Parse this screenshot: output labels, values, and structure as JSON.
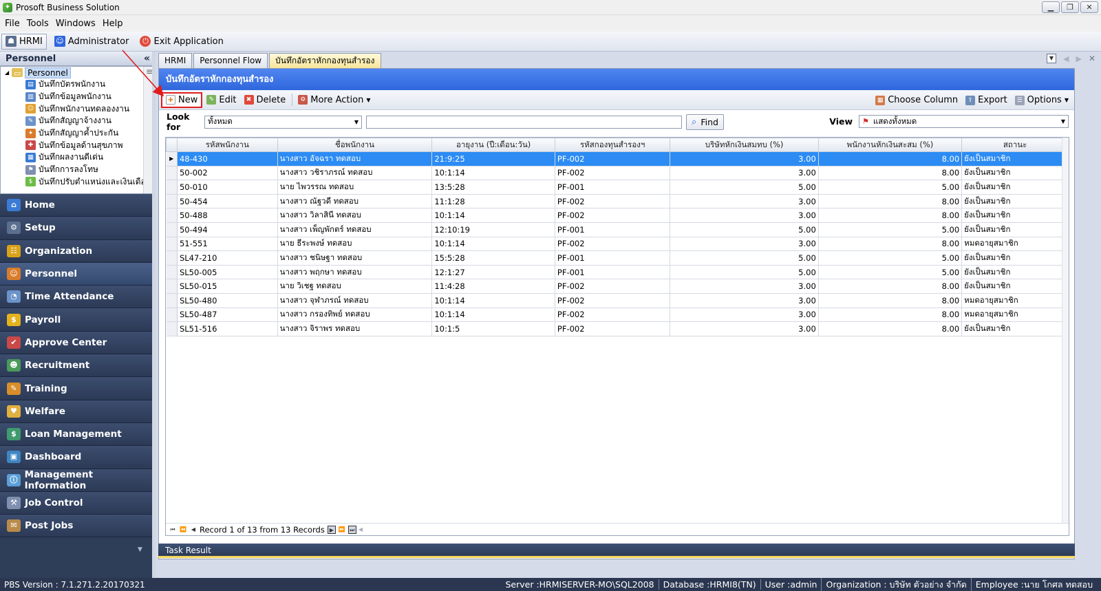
{
  "window": {
    "title": "Prosoft Business Solution",
    "controls": [
      "minimize",
      "restore",
      "close"
    ]
  },
  "menu": [
    "File",
    "Tools",
    "Windows",
    "Help"
  ],
  "toolbar": {
    "hrmi": "HRMI",
    "administrator": "Administrator",
    "exit": "Exit Application"
  },
  "sidebar": {
    "header": "Personnel",
    "tree_root": "Personnel",
    "tree_items": [
      "บันทึกบัตรพนักงาน",
      "บันทึกข้อมูลพนักงาน",
      "บันทึกพนักงานทดลองงาน",
      "บันทึกสัญญาจ้างงาน",
      "บันทึกสัญญาค้ำประกัน",
      "บันทึกข้อมูลด้านสุขภาพ",
      "บันทึกผลงานดีเด่น",
      "บันทึกการลงโทษ",
      "บันทึกปรับตำแหน่งและเงินเดือน"
    ],
    "nav": [
      {
        "label": "Home",
        "icon": "home-icon",
        "color": "#3a7bd5"
      },
      {
        "label": "Setup",
        "icon": "setup-icon",
        "color": "#5b6f90"
      },
      {
        "label": "Organization",
        "icon": "organization-icon",
        "color": "#d9a21a"
      },
      {
        "label": "Personnel",
        "icon": "personnel-icon",
        "color": "#d97c2b"
      },
      {
        "label": "Time Attendance",
        "icon": "time-attendance-icon",
        "color": "#6a93c9"
      },
      {
        "label": "Payroll",
        "icon": "payroll-icon",
        "color": "#e3b21c"
      },
      {
        "label": "Approve Center",
        "icon": "approve-center-icon",
        "color": "#c94848"
      },
      {
        "label": "Recruitment",
        "icon": "recruitment-icon",
        "color": "#4a9a5a"
      },
      {
        "label": "Training",
        "icon": "training-icon",
        "color": "#d98d2b"
      },
      {
        "label": "Welfare",
        "icon": "welfare-icon",
        "color": "#e0b040"
      },
      {
        "label": "Loan Management",
        "icon": "loan-management-icon",
        "color": "#3f9b6e"
      },
      {
        "label": "Dashboard",
        "icon": "dashboard-icon",
        "color": "#3e86c4"
      },
      {
        "label": "Management Information",
        "icon": "management-information-icon",
        "color": "#5aa0d8"
      },
      {
        "label": "Job Control",
        "icon": "job-control-icon",
        "color": "#7f8fb0"
      },
      {
        "label": "Post Jobs",
        "icon": "post-jobs-icon",
        "color": "#b98b4a"
      }
    ],
    "active_nav": "Personnel"
  },
  "tabs": [
    {
      "label": "HRMI",
      "active": false
    },
    {
      "label": "Personnel Flow",
      "active": false
    },
    {
      "label": "บันทึกอัตราหักกองทุนสำรอง",
      "active": true
    }
  ],
  "page": {
    "banner": "บันทึกอัตราหักกองทุนสำรอง",
    "actions": {
      "new": "New",
      "edit": "Edit",
      "delete": "Delete",
      "more_action": "More Action",
      "choose_column": "Choose Column",
      "export": "Export",
      "options": "Options"
    },
    "look_for_label": "Look for",
    "look_for_value": "ทั้งหมด",
    "search_value": "",
    "find": "Find",
    "view_label": "View",
    "view_value": "แสดงทั้งหมด"
  },
  "grid": {
    "columns": [
      "รหัสพนักงาน",
      "ชื่อพนักงาน",
      "อายุงาน (ปี:เดือน:วัน)",
      "รหัสกองทุนสำรองฯ",
      "บริษัทหักเงินสมทบ (%)",
      "พนักงานหักเงินสะสม (%)",
      "สถานะ"
    ],
    "rows": [
      [
        "48-430",
        "นางสาว อัจฉรา ทดสอบ",
        "21:9:25",
        "PF-002",
        "3.00",
        "8.00",
        "ยังเป็นสมาชิก"
      ],
      [
        "50-002",
        "นางสาว วชิราภรณ์ ทดสอบ",
        "10:1:14",
        "PF-002",
        "3.00",
        "8.00",
        "ยังเป็นสมาชิก"
      ],
      [
        "50-010",
        "นาย ไพวรรณ ทดสอบ",
        "13:5:28",
        "PF-001",
        "5.00",
        "5.00",
        "ยังเป็นสมาชิก"
      ],
      [
        "50-454",
        "นางสาว ณัฐวดี ทดสอบ",
        "11:1:28",
        "PF-002",
        "3.00",
        "8.00",
        "ยังเป็นสมาชิก"
      ],
      [
        "50-488",
        "นางสาว วิลาสินี ทดสอบ",
        "10:1:14",
        "PF-002",
        "3.00",
        "8.00",
        "ยังเป็นสมาชิก"
      ],
      [
        "50-494",
        "นางสาว เพ็ญพักตร์ ทดสอบ",
        "12:10:19",
        "PF-001",
        "5.00",
        "5.00",
        "ยังเป็นสมาชิก"
      ],
      [
        "51-551",
        "นาย ธีระพงษ์ ทดสอบ",
        "10:1:14",
        "PF-002",
        "3.00",
        "8.00",
        "หมดอายุสมาชิก"
      ],
      [
        "SL47-210",
        "นางสาว ชนิษฐา ทดสอบ",
        "15:5:28",
        "PF-001",
        "5.00",
        "5.00",
        "ยังเป็นสมาชิก"
      ],
      [
        "SL50-005",
        "นางสาว พฤกษา ทดสอบ",
        "12:1:27",
        "PF-001",
        "5.00",
        "5.00",
        "ยังเป็นสมาชิก"
      ],
      [
        "SL50-015",
        "นาย วิเชฐ ทดสอบ",
        "11:4:28",
        "PF-002",
        "3.00",
        "8.00",
        "ยังเป็นสมาชิก"
      ],
      [
        "SL50-480",
        "นางสาว จุฬาภรณ์ ทดสอบ",
        "10:1:14",
        "PF-002",
        "3.00",
        "8.00",
        "หมดอายุสมาชิก"
      ],
      [
        "SL50-487",
        "นางสาว กรองทิพย์ ทดสอบ",
        "10:1:14",
        "PF-002",
        "3.00",
        "8.00",
        "หมดอายุสมาชิก"
      ],
      [
        "SL51-516",
        "นางสาว จิราพร ทดสอบ",
        "10:1:5",
        "PF-002",
        "3.00",
        "8.00",
        "ยังเป็นสมาชิก"
      ]
    ],
    "selected_row": 0,
    "record_text": "Record 1 of 13 from 13 Records"
  },
  "task_result": "Task Result",
  "status": {
    "version": "PBS Version : 7.1.271.2.20170321",
    "server": "Server :HRMISERVER-MO\\SQL2008",
    "database": "Database :HRMI8(TN)",
    "user": "User :admin",
    "organization": "Organization : บริษัท ตัวอย่าง จำกัด",
    "employee": "Employee :นาย โกศล ทดสอบ"
  },
  "colors": {
    "banner": "#3a74e6",
    "selected_row": "#2c8cf4",
    "sidebar_bg": "#2e3d58",
    "highlight_box": "#e01d1d",
    "active_tab": "#f6e59a"
  }
}
